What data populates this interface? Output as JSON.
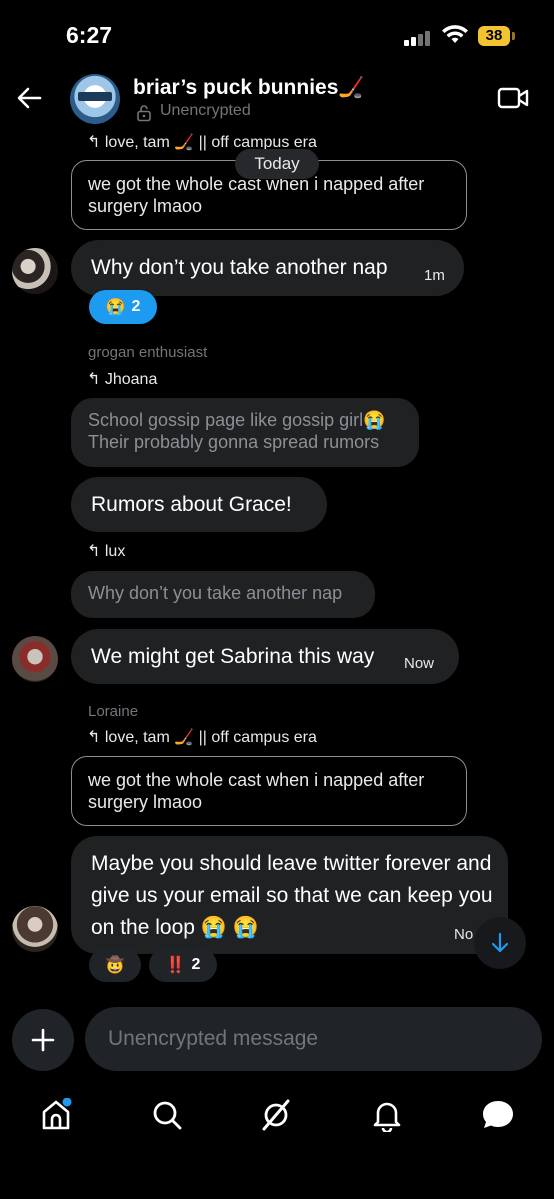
{
  "status_bar": {
    "time": "6:27",
    "battery": "38"
  },
  "header": {
    "title": "briar’s puck bunnies🏒",
    "encryption": "Unencrypted"
  },
  "date_divider": "Today",
  "messages": {
    "m1": {
      "reply_to": "love, tam 🏒 || off campus era",
      "quoted": "we got the whole cast when i napped after surgery lmaoo"
    },
    "m2": {
      "text": "Why don’t you take another nap",
      "time": "1m",
      "reaction_emoji": "😭",
      "reaction_count": "2"
    },
    "m3": {
      "sender": "grogan enthusiast",
      "reply_to": "Jhoana",
      "quoted": "School gossip page like gossip girl😭 Their probably gonna spread rumors",
      "text": "Rumors about Grace!"
    },
    "m4": {
      "reply_to": "lux",
      "quoted": "Why don’t you take another nap",
      "text": "We might get Sabrina this way",
      "time": "Now"
    },
    "m5": {
      "sender": "Loraine",
      "reply_to": "love, tam 🏒 || off campus era",
      "quoted": "we got the whole cast when i napped after surgery lmaoo",
      "text": "Maybe you should leave twitter forever and give us your email so that we can keep you on the loop 😭 😭",
      "time": "No",
      "reaction1_emoji": "🤠",
      "reaction2_emoji": "‼️",
      "reaction2_count": "2"
    }
  },
  "composer": {
    "placeholder": "Unencrypted message"
  },
  "icons": [
    "back-arrow-icon",
    "lock-icon",
    "video-camera-icon",
    "plus-icon",
    "arrow-down-icon",
    "home-icon",
    "search-icon",
    "grok-icon",
    "bell-icon",
    "messages-icon"
  ],
  "colors": {
    "accent": "#1d9bf0",
    "battery": "#f4c430",
    "bubble": "#1f2123"
  }
}
